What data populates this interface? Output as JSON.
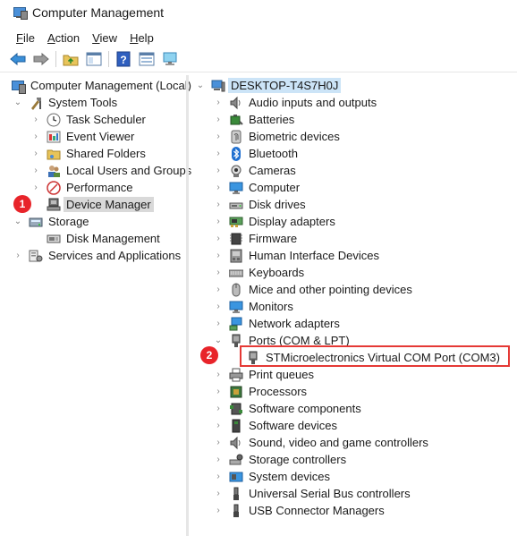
{
  "window": {
    "title": "Computer Management"
  },
  "menu": [
    {
      "label": "File",
      "key": "F",
      "rest": "ile"
    },
    {
      "label": "Action",
      "key": "A",
      "rest": "ction"
    },
    {
      "label": "View",
      "key": "V",
      "rest": "iew"
    },
    {
      "label": "Help",
      "key": "H",
      "rest": "elp"
    }
  ],
  "toolbar": [
    "back-icon",
    "forward-icon",
    "up-folder-icon",
    "show-hide-tree-icon",
    "help-icon",
    "properties-icon",
    "monitor-icon"
  ],
  "left_tree": {
    "root": "Computer Management (Local)",
    "system_tools": "System Tools",
    "task_scheduler": "Task Scheduler",
    "event_viewer": "Event Viewer",
    "shared_folders": "Shared Folders",
    "local_users": "Local Users and Groups",
    "performance": "Performance",
    "device_manager": "Device Manager",
    "storage": "Storage",
    "disk_management": "Disk Management",
    "services": "Services and Applications"
  },
  "right_tree": {
    "computer": "DESKTOP-T4S7H0J",
    "items": [
      "Audio inputs and outputs",
      "Batteries",
      "Biometric devices",
      "Bluetooth",
      "Cameras",
      "Computer",
      "Disk drives",
      "Display adapters",
      "Firmware",
      "Human Interface Devices",
      "Keyboards",
      "Mice and other pointing devices",
      "Monitors",
      "Network adapters",
      "Ports (COM & LPT)",
      "STMicroelectronics Virtual COM Port (COM3)",
      "Print queues",
      "Processors",
      "Software components",
      "Software devices",
      "Sound, video and game controllers",
      "Storage controllers",
      "System devices",
      "Universal Serial Bus controllers",
      "USB Connector Managers"
    ]
  },
  "annotations": {
    "step1": "1",
    "step2": "2"
  },
  "colors": {
    "badge": "#e8242a",
    "highlight": "#e53935",
    "selection": "#d9d9d9",
    "root_selection": "#cce4f7"
  }
}
